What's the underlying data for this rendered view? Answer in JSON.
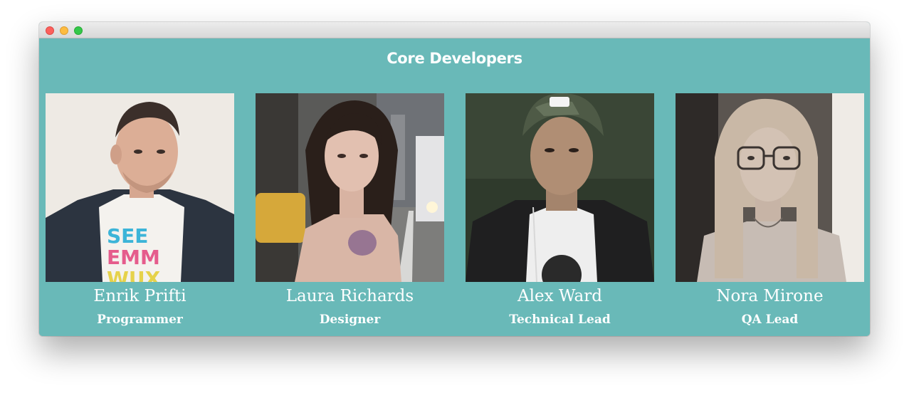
{
  "window": {
    "controls": [
      "close",
      "minimize",
      "maximize"
    ]
  },
  "section": {
    "title": "Core Developers",
    "background": "#69b9b8"
  },
  "members": [
    {
      "name": "Enrik Prifti",
      "role": "Programmer",
      "photo_icon": "portrait-photo",
      "shirt_text": [
        "SEE",
        "EMM",
        "WUX"
      ]
    },
    {
      "name": "Laura Richards",
      "role": "Designer",
      "photo_icon": "portrait-photo"
    },
    {
      "name": "Alex Ward",
      "role": "Technical Lead",
      "photo_icon": "portrait-photo"
    },
    {
      "name": "Nora Mirone",
      "role": "QA Lead",
      "photo_icon": "portrait-photo"
    }
  ]
}
